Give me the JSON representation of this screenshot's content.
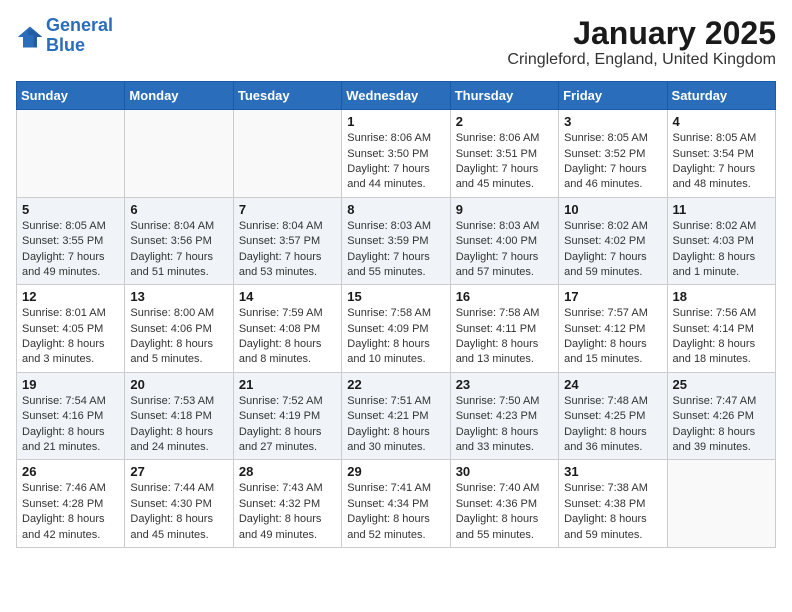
{
  "header": {
    "logo_line1": "General",
    "logo_line2": "Blue",
    "month_title": "January 2025",
    "location": "Cringleford, England, United Kingdom"
  },
  "weekdays": [
    "Sunday",
    "Monday",
    "Tuesday",
    "Wednesday",
    "Thursday",
    "Friday",
    "Saturday"
  ],
  "weeks": [
    [
      {
        "day": "",
        "sunrise": "",
        "sunset": "",
        "daylight": ""
      },
      {
        "day": "",
        "sunrise": "",
        "sunset": "",
        "daylight": ""
      },
      {
        "day": "",
        "sunrise": "",
        "sunset": "",
        "daylight": ""
      },
      {
        "day": "1",
        "sunrise": "Sunrise: 8:06 AM",
        "sunset": "Sunset: 3:50 PM",
        "daylight": "Daylight: 7 hours and 44 minutes."
      },
      {
        "day": "2",
        "sunrise": "Sunrise: 8:06 AM",
        "sunset": "Sunset: 3:51 PM",
        "daylight": "Daylight: 7 hours and 45 minutes."
      },
      {
        "day": "3",
        "sunrise": "Sunrise: 8:05 AM",
        "sunset": "Sunset: 3:52 PM",
        "daylight": "Daylight: 7 hours and 46 minutes."
      },
      {
        "day": "4",
        "sunrise": "Sunrise: 8:05 AM",
        "sunset": "Sunset: 3:54 PM",
        "daylight": "Daylight: 7 hours and 48 minutes."
      }
    ],
    [
      {
        "day": "5",
        "sunrise": "Sunrise: 8:05 AM",
        "sunset": "Sunset: 3:55 PM",
        "daylight": "Daylight: 7 hours and 49 minutes."
      },
      {
        "day": "6",
        "sunrise": "Sunrise: 8:04 AM",
        "sunset": "Sunset: 3:56 PM",
        "daylight": "Daylight: 7 hours and 51 minutes."
      },
      {
        "day": "7",
        "sunrise": "Sunrise: 8:04 AM",
        "sunset": "Sunset: 3:57 PM",
        "daylight": "Daylight: 7 hours and 53 minutes."
      },
      {
        "day": "8",
        "sunrise": "Sunrise: 8:03 AM",
        "sunset": "Sunset: 3:59 PM",
        "daylight": "Daylight: 7 hours and 55 minutes."
      },
      {
        "day": "9",
        "sunrise": "Sunrise: 8:03 AM",
        "sunset": "Sunset: 4:00 PM",
        "daylight": "Daylight: 7 hours and 57 minutes."
      },
      {
        "day": "10",
        "sunrise": "Sunrise: 8:02 AM",
        "sunset": "Sunset: 4:02 PM",
        "daylight": "Daylight: 7 hours and 59 minutes."
      },
      {
        "day": "11",
        "sunrise": "Sunrise: 8:02 AM",
        "sunset": "Sunset: 4:03 PM",
        "daylight": "Daylight: 8 hours and 1 minute."
      }
    ],
    [
      {
        "day": "12",
        "sunrise": "Sunrise: 8:01 AM",
        "sunset": "Sunset: 4:05 PM",
        "daylight": "Daylight: 8 hours and 3 minutes."
      },
      {
        "day": "13",
        "sunrise": "Sunrise: 8:00 AM",
        "sunset": "Sunset: 4:06 PM",
        "daylight": "Daylight: 8 hours and 5 minutes."
      },
      {
        "day": "14",
        "sunrise": "Sunrise: 7:59 AM",
        "sunset": "Sunset: 4:08 PM",
        "daylight": "Daylight: 8 hours and 8 minutes."
      },
      {
        "day": "15",
        "sunrise": "Sunrise: 7:58 AM",
        "sunset": "Sunset: 4:09 PM",
        "daylight": "Daylight: 8 hours and 10 minutes."
      },
      {
        "day": "16",
        "sunrise": "Sunrise: 7:58 AM",
        "sunset": "Sunset: 4:11 PM",
        "daylight": "Daylight: 8 hours and 13 minutes."
      },
      {
        "day": "17",
        "sunrise": "Sunrise: 7:57 AM",
        "sunset": "Sunset: 4:12 PM",
        "daylight": "Daylight: 8 hours and 15 minutes."
      },
      {
        "day": "18",
        "sunrise": "Sunrise: 7:56 AM",
        "sunset": "Sunset: 4:14 PM",
        "daylight": "Daylight: 8 hours and 18 minutes."
      }
    ],
    [
      {
        "day": "19",
        "sunrise": "Sunrise: 7:54 AM",
        "sunset": "Sunset: 4:16 PM",
        "daylight": "Daylight: 8 hours and 21 minutes."
      },
      {
        "day": "20",
        "sunrise": "Sunrise: 7:53 AM",
        "sunset": "Sunset: 4:18 PM",
        "daylight": "Daylight: 8 hours and 24 minutes."
      },
      {
        "day": "21",
        "sunrise": "Sunrise: 7:52 AM",
        "sunset": "Sunset: 4:19 PM",
        "daylight": "Daylight: 8 hours and 27 minutes."
      },
      {
        "day": "22",
        "sunrise": "Sunrise: 7:51 AM",
        "sunset": "Sunset: 4:21 PM",
        "daylight": "Daylight: 8 hours and 30 minutes."
      },
      {
        "day": "23",
        "sunrise": "Sunrise: 7:50 AM",
        "sunset": "Sunset: 4:23 PM",
        "daylight": "Daylight: 8 hours and 33 minutes."
      },
      {
        "day": "24",
        "sunrise": "Sunrise: 7:48 AM",
        "sunset": "Sunset: 4:25 PM",
        "daylight": "Daylight: 8 hours and 36 minutes."
      },
      {
        "day": "25",
        "sunrise": "Sunrise: 7:47 AM",
        "sunset": "Sunset: 4:26 PM",
        "daylight": "Daylight: 8 hours and 39 minutes."
      }
    ],
    [
      {
        "day": "26",
        "sunrise": "Sunrise: 7:46 AM",
        "sunset": "Sunset: 4:28 PM",
        "daylight": "Daylight: 8 hours and 42 minutes."
      },
      {
        "day": "27",
        "sunrise": "Sunrise: 7:44 AM",
        "sunset": "Sunset: 4:30 PM",
        "daylight": "Daylight: 8 hours and 45 minutes."
      },
      {
        "day": "28",
        "sunrise": "Sunrise: 7:43 AM",
        "sunset": "Sunset: 4:32 PM",
        "daylight": "Daylight: 8 hours and 49 minutes."
      },
      {
        "day": "29",
        "sunrise": "Sunrise: 7:41 AM",
        "sunset": "Sunset: 4:34 PM",
        "daylight": "Daylight: 8 hours and 52 minutes."
      },
      {
        "day": "30",
        "sunrise": "Sunrise: 7:40 AM",
        "sunset": "Sunset: 4:36 PM",
        "daylight": "Daylight: 8 hours and 55 minutes."
      },
      {
        "day": "31",
        "sunrise": "Sunrise: 7:38 AM",
        "sunset": "Sunset: 4:38 PM",
        "daylight": "Daylight: 8 hours and 59 minutes."
      },
      {
        "day": "",
        "sunrise": "",
        "sunset": "",
        "daylight": ""
      }
    ]
  ]
}
